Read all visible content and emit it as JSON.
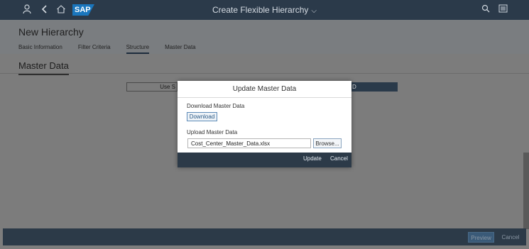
{
  "shell": {
    "logo": "SAP",
    "app_title": "Create Flexible Hierarchy",
    "title_chevron": "⌵"
  },
  "header": {
    "title": "New Hierarchy",
    "tabs": [
      {
        "label": "Basic Information"
      },
      {
        "label": "Filter Criteria"
      },
      {
        "label": "Structure"
      },
      {
        "label": "Master Data"
      }
    ],
    "active_tab": "Structure"
  },
  "section": {
    "title": "Master Data",
    "left_button_partial": "Use S",
    "right_button_partial": "D"
  },
  "dialog": {
    "title": "Update Master Data",
    "download_label": "Download Master Data",
    "download_button": "Download",
    "upload_label": "Upload Master Data",
    "file_value": "Cost_Center_Master_Data.xlsx",
    "browse_button": "Browse...",
    "update_button": "Update",
    "cancel_button": "Cancel"
  },
  "footer": {
    "preview_button": "Preview",
    "cancel_button": "Cancel"
  },
  "colors": {
    "shell_bar": "#2b3a4a",
    "brand_blue": "#1a76bd",
    "overlay": "#7c7c7c",
    "dialog_footer": "#2c3a48"
  }
}
